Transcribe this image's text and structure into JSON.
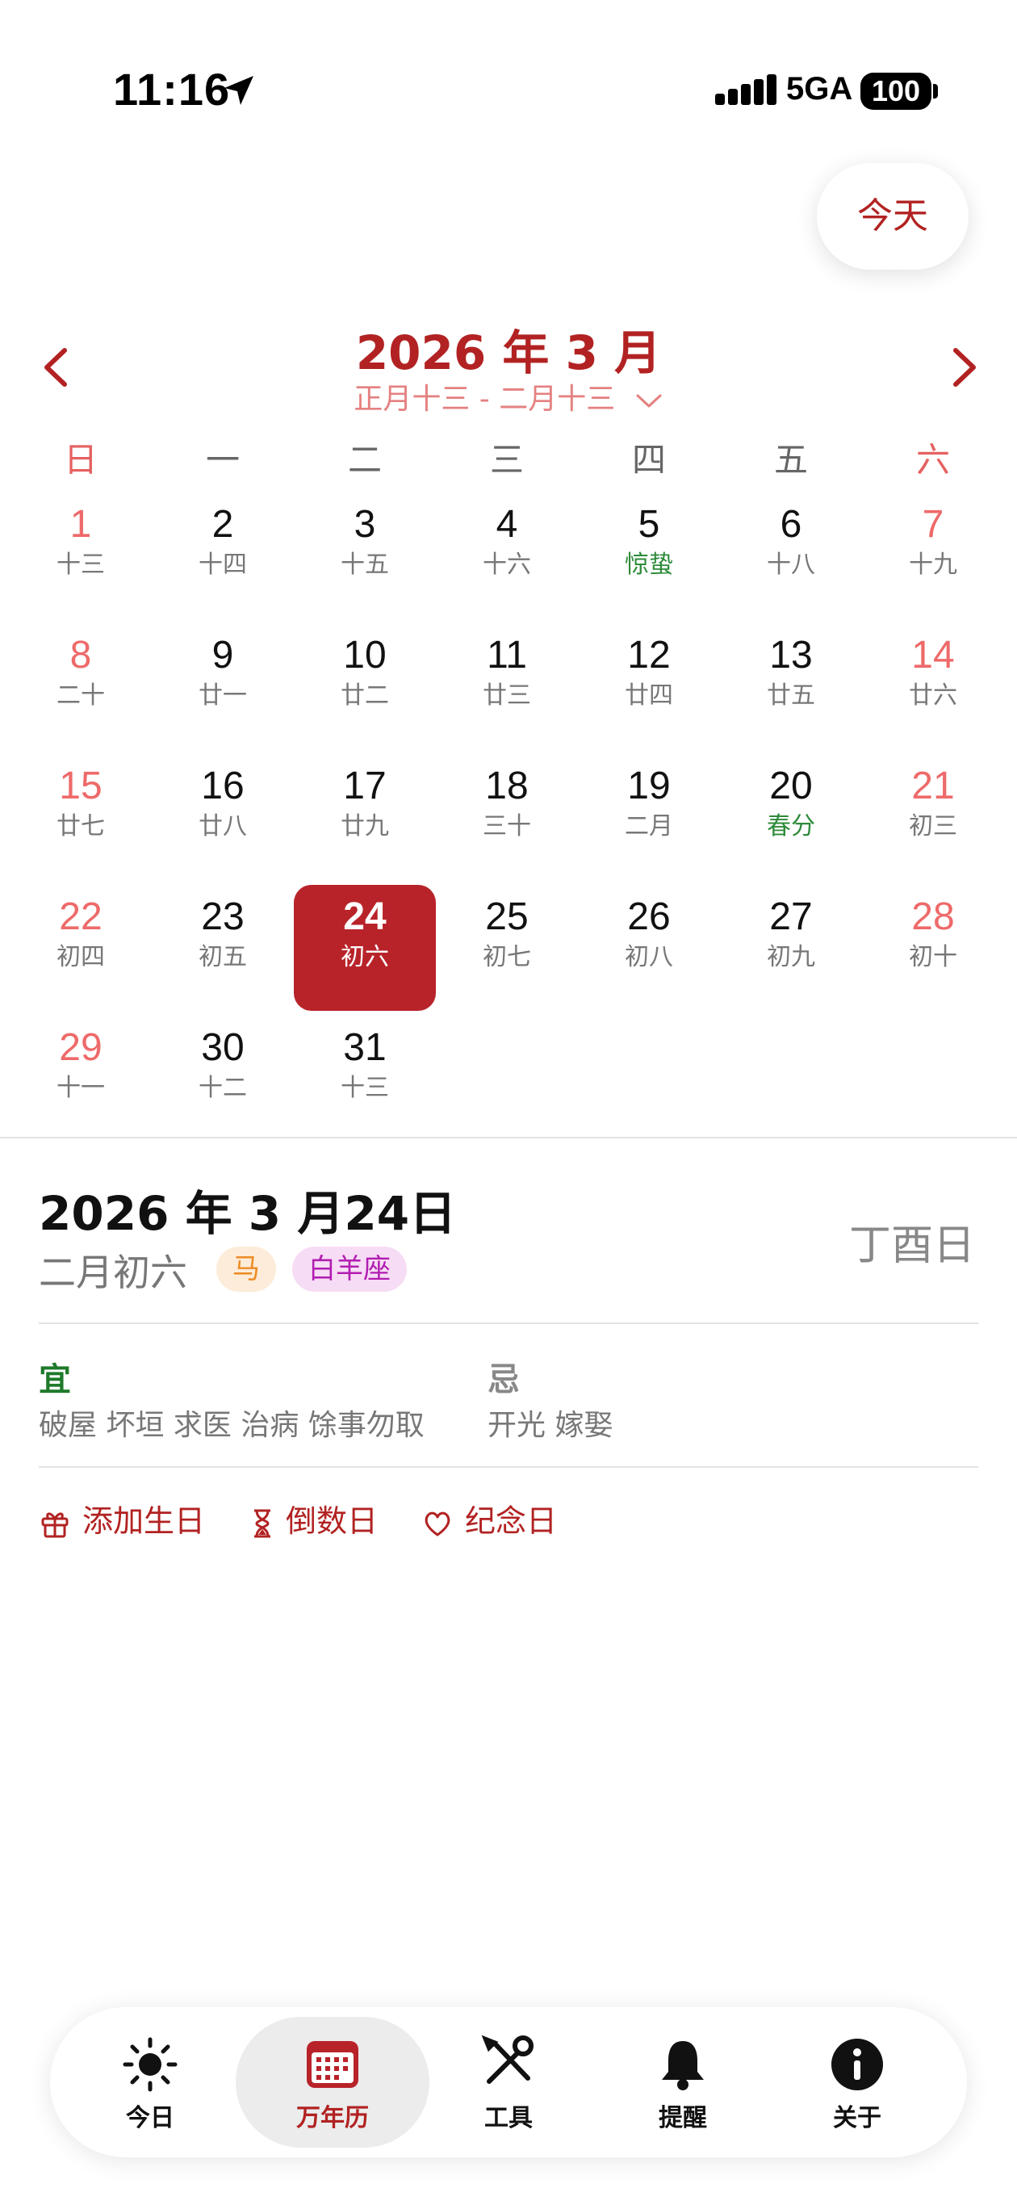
{
  "status": {
    "time": "11:16",
    "network": "5GA",
    "battery": "100"
  },
  "today_button": "今天",
  "header": {
    "month_title": "2026 年 3 月",
    "lunar_range": "正月十三 - 二月十三"
  },
  "weekdays": [
    "日",
    "一",
    "二",
    "三",
    "四",
    "五",
    "六"
  ],
  "days": [
    {
      "num": "1",
      "lunar": "十三"
    },
    {
      "num": "2",
      "lunar": "十四"
    },
    {
      "num": "3",
      "lunar": "十五"
    },
    {
      "num": "4",
      "lunar": "十六"
    },
    {
      "num": "5",
      "lunar": "惊蛰"
    },
    {
      "num": "6",
      "lunar": "十八"
    },
    {
      "num": "7",
      "lunar": "十九"
    },
    {
      "num": "8",
      "lunar": "二十"
    },
    {
      "num": "9",
      "lunar": "廿一"
    },
    {
      "num": "10",
      "lunar": "廿二"
    },
    {
      "num": "11",
      "lunar": "廿三"
    },
    {
      "num": "12",
      "lunar": "廿四"
    },
    {
      "num": "13",
      "lunar": "廿五"
    },
    {
      "num": "14",
      "lunar": "廿六"
    },
    {
      "num": "15",
      "lunar": "廿七"
    },
    {
      "num": "16",
      "lunar": "廿八"
    },
    {
      "num": "17",
      "lunar": "廿九"
    },
    {
      "num": "18",
      "lunar": "三十"
    },
    {
      "num": "19",
      "lunar": "二月"
    },
    {
      "num": "20",
      "lunar": "春分"
    },
    {
      "num": "21",
      "lunar": "初三"
    },
    {
      "num": "22",
      "lunar": "初四"
    },
    {
      "num": "23",
      "lunar": "初五"
    },
    {
      "num": "24",
      "lunar": "初六"
    },
    {
      "num": "25",
      "lunar": "初七"
    },
    {
      "num": "26",
      "lunar": "初八"
    },
    {
      "num": "27",
      "lunar": "初九"
    },
    {
      "num": "28",
      "lunar": "初十"
    },
    {
      "num": "29",
      "lunar": "十一"
    },
    {
      "num": "30",
      "lunar": "十二"
    },
    {
      "num": "31",
      "lunar": "十三"
    }
  ],
  "selected_day": "24",
  "solar_terms": [
    "5",
    "20"
  ],
  "detail": {
    "date": "2026 年 3 月24日",
    "lunar": "二月初六",
    "zodiac": "马",
    "star_sign": "白羊座",
    "ganzhi": "丁酉日",
    "yi_title": "宜",
    "yi_items": "破屋 坏垣 求医 治病 馀事勿取",
    "ji_title": "忌",
    "ji_items": "开光 嫁娶"
  },
  "actions": {
    "birthday": "添加生日",
    "countdown": "倒数日",
    "anniversary": "纪念日"
  },
  "tabs": [
    {
      "label": "今日",
      "icon": "sun-icon"
    },
    {
      "label": "万年历",
      "icon": "calendar-icon"
    },
    {
      "label": "工具",
      "icon": "tools-icon"
    },
    {
      "label": "提醒",
      "icon": "bell-icon"
    },
    {
      "label": "关于",
      "icon": "info-icon"
    }
  ],
  "colors": {
    "accent": "#b8232a",
    "weekend": "#ee6a6a",
    "solar_term": "#2e8b3a"
  }
}
